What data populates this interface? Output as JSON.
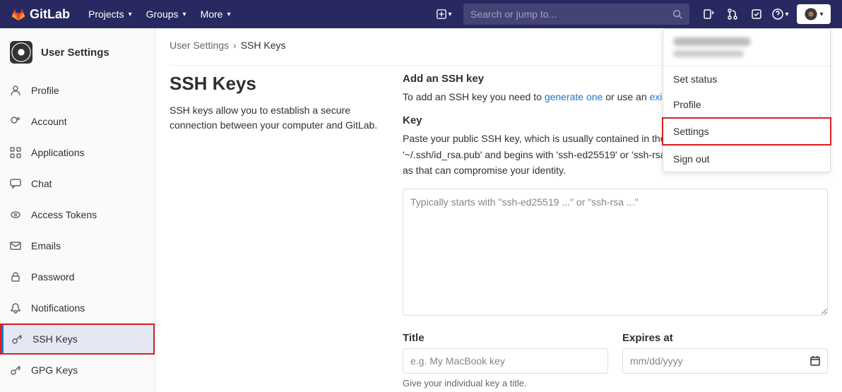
{
  "nav": {
    "brand": "GitLab",
    "projects": "Projects",
    "groups": "Groups",
    "more": "More",
    "search_placeholder": "Search or jump to..."
  },
  "sidebar": {
    "title": "User Settings",
    "items": [
      {
        "label": "Profile"
      },
      {
        "label": "Account"
      },
      {
        "label": "Applications"
      },
      {
        "label": "Chat"
      },
      {
        "label": "Access Tokens"
      },
      {
        "label": "Emails"
      },
      {
        "label": "Password"
      },
      {
        "label": "Notifications"
      },
      {
        "label": "SSH Keys"
      },
      {
        "label": "GPG Keys"
      }
    ]
  },
  "breadcrumb": {
    "root": "User Settings",
    "current": "SSH Keys"
  },
  "main": {
    "title": "SSH Keys",
    "desc": "SSH keys allow you to establish a secure connection between your computer and GitLab.",
    "add_heading": "Add an SSH key",
    "add_text_pre": "To add an SSH key you need to ",
    "add_link1": "generate one",
    "add_text_mid": " or use an ",
    "add_link2": "existing key.",
    "key_label": "Key",
    "key_help": "Paste your public SSH key, which is usually contained in the file '~/.ssh/id_ed25519.pub' or '~/.ssh/id_rsa.pub' and begins with 'ssh-ed25519' or 'ssh-rsa'. Do not paste your private SSH key, as that can compromise your identity.",
    "key_placeholder": "Typically starts with \"ssh-ed25519 ...\" or \"ssh-rsa ...\"",
    "title_label": "Title",
    "title_placeholder": "e.g. My MacBook key",
    "title_hint": "Give your individual key a title.",
    "expires_label": "Expires at",
    "expires_placeholder": "mm/dd/yyyy"
  },
  "user_menu": {
    "set_status": "Set status",
    "profile": "Profile",
    "settings": "Settings",
    "sign_out": "Sign out"
  }
}
